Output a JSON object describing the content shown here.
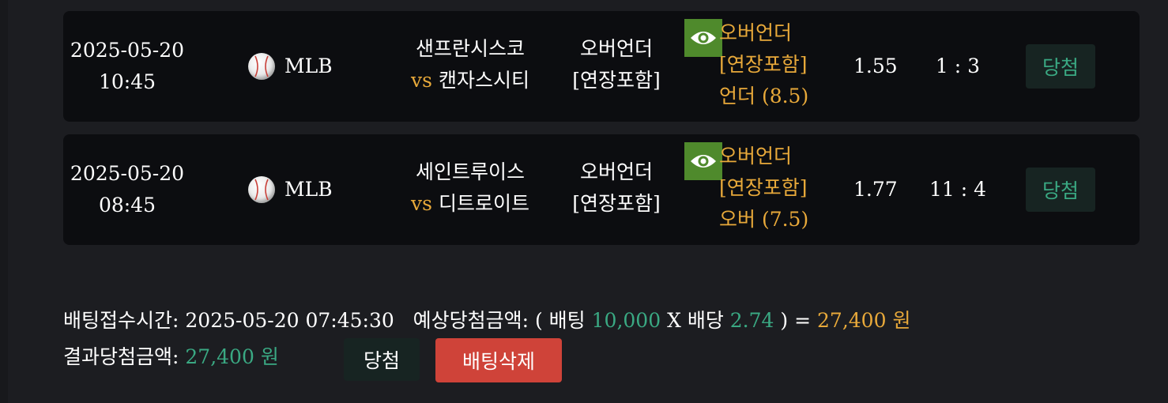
{
  "bets": [
    {
      "date": "2025-05-20",
      "time": "10:45",
      "league": "MLB",
      "home_team": "샌프란시스코",
      "vs": "vs",
      "away_team": "캔자스시티",
      "market_line1": "오버언더",
      "market_line2": "[연장포함]",
      "pick_line1": "오버언더",
      "pick_line2": "[연장포함]",
      "pick_line3": "언더 (8.5)",
      "odds": "1.55",
      "score": "1 : 3",
      "result": "당첨"
    },
    {
      "date": "2025-05-20",
      "time": "08:45",
      "league": "MLB",
      "home_team": "세인트루이스",
      "vs": "vs",
      "away_team": "디트로이트",
      "market_line1": "오버언더",
      "market_line2": "[연장포함]",
      "pick_line1": "오버언더",
      "pick_line2": "[연장포함]",
      "pick_line3": "오버 (7.5)",
      "odds": "1.77",
      "score": "11 : 4",
      "result": "당첨"
    }
  ],
  "summary": {
    "bet_time_label": "배팅접수시간:",
    "bet_time": "2025-05-20 07:45:30",
    "expected_label": "예상당첨금액: ( 배팅",
    "stake": "10,000",
    "times": "X 배당",
    "total_odds": "2.74",
    "equals": ") =",
    "expected_amount": "27,400 원",
    "result_label": "결과당첨금액:",
    "result_amount": "27,400 원",
    "status": "당첨",
    "delete_label": "배팅삭제"
  },
  "colors": {
    "accent_gold": "#e8a93a",
    "accent_green": "#3aa983",
    "eye_button": "#4f8a2c",
    "delete_button": "#cf4339"
  },
  "icons": {
    "sport": "baseball-icon",
    "view": "eye-icon"
  }
}
